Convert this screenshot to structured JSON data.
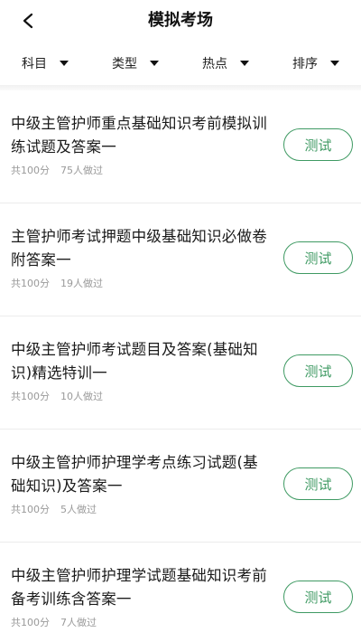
{
  "header": {
    "title": "模拟考场"
  },
  "filters": [
    {
      "label": "科目"
    },
    {
      "label": "类型"
    },
    {
      "label": "热点"
    },
    {
      "label": "排序"
    }
  ],
  "exams": [
    {
      "title": "中级主管护师重点基础知识考前模拟训练试题及答案一",
      "score": "共100分",
      "done": "75人做过",
      "button": "测试"
    },
    {
      "title": "主管护师考试押题中级基础知识必做卷附答案一",
      "score": "共100分",
      "done": "19人做过",
      "button": "测试"
    },
    {
      "title": "中级主管护师考试题目及答案(基础知识)精选特训一",
      "score": "共100分",
      "done": "10人做过",
      "button": "测试"
    },
    {
      "title": "中级主管护师护理学考点练习试题(基础知识)及答案一",
      "score": "共100分",
      "done": "5人做过",
      "button": "测试"
    },
    {
      "title": "中级主管护师护理学试题基础知识考前备考训练含答案一",
      "score": "共100分",
      "done": "7人做过",
      "button": "测试"
    }
  ]
}
